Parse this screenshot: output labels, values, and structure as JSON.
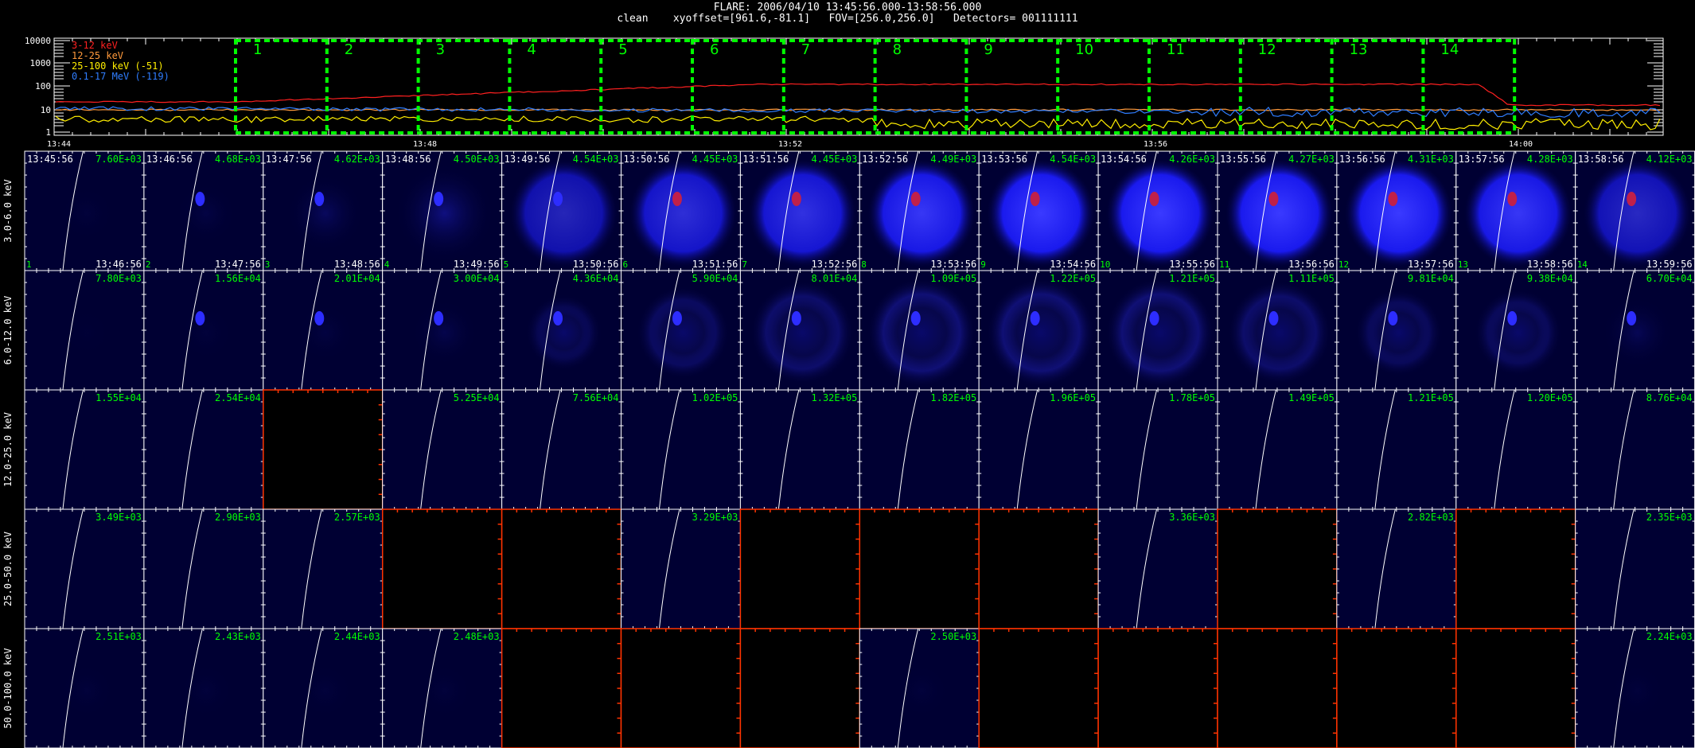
{
  "header": {
    "title": "FLARE: 2006/04/10 13:45:56.000-13:58:56.000",
    "subtitle": "clean    xyoffset=[961.6,-81.1]   FOV=[256.0,256.0]   Detectors= 001111111"
  },
  "lightcurve": {
    "y_ticks": [
      "10000",
      "1000",
      "100",
      "10",
      "1"
    ],
    "x_ticks": [
      "13:44",
      "13:48",
      "13:52",
      "13:56",
      "14:00"
    ],
    "legend": [
      {
        "label": "3-12 keV",
        "color": "#ff2020"
      },
      {
        "label": "12-25 keV",
        "color": "#ff9a3c"
      },
      {
        "label": "25-100 keV (-51)",
        "color": "#ffee00"
      },
      {
        "label": "0.1-17 MeV (-119)",
        "color": "#2f7dff"
      }
    ],
    "intervals": [
      "1",
      "2",
      "3",
      "4",
      "5",
      "6",
      "7",
      "8",
      "9",
      "10",
      "11",
      "12",
      "13",
      "14"
    ],
    "interval_color": "#00ff00"
  },
  "grid": {
    "energy_bands": [
      "3.0-6.0 keV",
      "6.0-12.0 keV",
      "12.0-25.0 keV",
      "25.0-50.0 keV",
      "50.0-100.0 keV"
    ],
    "start_times": [
      "13:45:56",
      "13:46:56",
      "13:47:56",
      "13:48:56",
      "13:49:56",
      "13:50:56",
      "13:51:56",
      "13:52:56",
      "13:53:56",
      "13:54:56",
      "13:55:56",
      "13:56:56",
      "13:57:56",
      "13:58:56"
    ],
    "end_times": [
      "13:46:56",
      "13:47:56",
      "13:48:56",
      "13:49:56",
      "13:50:56",
      "13:51:56",
      "13:52:56",
      "13:53:56",
      "13:54:56",
      "13:55:56",
      "13:56:56",
      "13:57:56",
      "13:58:56",
      "13:59:56"
    ],
    "maxvals": [
      [
        "7.60E+03",
        "4.68E+03",
        "4.62E+03",
        "4.50E+03",
        "4.54E+03",
        "4.45E+03",
        "4.45E+03",
        "4.49E+03",
        "4.54E+03",
        "4.26E+03",
        "4.27E+03",
        "4.31E+03",
        "4.28E+03",
        "4.12E+03"
      ],
      [
        "7.80E+03",
        "1.56E+04",
        "2.01E+04",
        "3.00E+04",
        "4.36E+04",
        "5.90E+04",
        "8.01E+04",
        "1.09E+05",
        "1.22E+05",
        "1.21E+05",
        "1.11E+05",
        "9.81E+04",
        "9.38E+04",
        "6.70E+04"
      ],
      [
        "1.55E+04",
        "2.54E+04",
        "",
        "5.25E+04",
        "7.56E+04",
        "1.02E+05",
        "1.32E+05",
        "1.82E+05",
        "1.96E+05",
        "1.78E+05",
        "1.49E+05",
        "1.21E+05",
        "1.20E+05",
        "8.76E+04"
      ],
      [
        "3.49E+03",
        "2.90E+03",
        "2.57E+03",
        "",
        "",
        "3.29E+03",
        "",
        "",
        "",
        "3.36E+03",
        "",
        "2.82E+03",
        "",
        "2.35E+03"
      ],
      [
        "2.51E+03",
        "2.43E+03",
        "2.44E+03",
        "2.48E+03",
        "",
        "",
        "",
        "2.50E+03",
        "",
        "",
        "",
        "",
        "",
        "2.24E+03"
      ]
    ],
    "empty_cells": [
      [],
      [],
      [
        2
      ],
      [
        3,
        4,
        6,
        7,
        8,
        10,
        12
      ],
      [
        4,
        5,
        6,
        8,
        9,
        10,
        11,
        12
      ]
    ],
    "blob_intensity": [
      [
        0.05,
        0.1,
        0.25,
        0.45,
        0.65,
        0.8,
        0.85,
        0.95,
        1.0,
        1.0,
        1.0,
        1.0,
        0.95,
        0.7
      ],
      [
        0.02,
        0.05,
        0.08,
        0.15,
        0.25,
        0.4,
        0.5,
        0.6,
        0.6,
        0.6,
        0.5,
        0.35,
        0.35,
        0.2
      ],
      [
        0,
        0,
        0,
        0,
        0,
        0,
        0,
        0,
        0,
        0,
        0,
        0,
        0,
        0
      ],
      [
        0,
        0,
        0,
        0,
        0,
        0,
        0,
        0,
        0,
        0,
        0,
        0,
        0,
        0
      ],
      [
        0.05,
        0.05,
        0.05,
        0.05,
        0,
        0,
        0,
        0.05,
        0,
        0,
        0,
        0,
        0,
        0.05
      ]
    ],
    "colors": {
      "panel_bg": "#000033",
      "limb": "#ffffff",
      "maxval": "#00ff00",
      "empty_border": "#ff3300"
    }
  }
}
